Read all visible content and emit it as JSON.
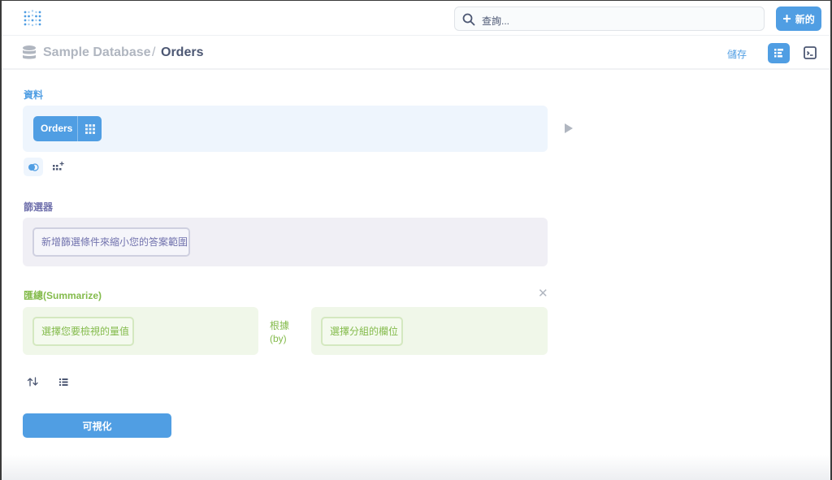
{
  "topnav": {
    "search_placeholder": "查詢...",
    "new_label": "新的"
  },
  "header": {
    "database": "Sample Database",
    "separator": "/",
    "table": "Orders",
    "save_label": "儲存"
  },
  "data_section": {
    "title": "資料",
    "source_table": "Orders"
  },
  "filter_section": {
    "title": "篩選器",
    "add_filter_label": "新增篩選條件來縮小您的答案範圍"
  },
  "summarize_section": {
    "title": "匯總(Summarize)",
    "metric_label": "選擇您要檢視的量值",
    "by_label": "根據 (by)",
    "group_label": "選擇分組的欄位"
  },
  "actions": {
    "visualize_label": "可視化"
  },
  "colors": {
    "brand": "#509ee3",
    "filter": "#7172ad",
    "summarize": "#84bb4c"
  },
  "icons": [
    "metabase-logo-icon",
    "search-icon",
    "plus-icon",
    "database-icon",
    "notebook-icon",
    "sql-console-icon",
    "grid-icon",
    "play-icon",
    "toggle-icon",
    "add-column-icon",
    "close-icon",
    "sort-icon",
    "limit-list-icon"
  ]
}
